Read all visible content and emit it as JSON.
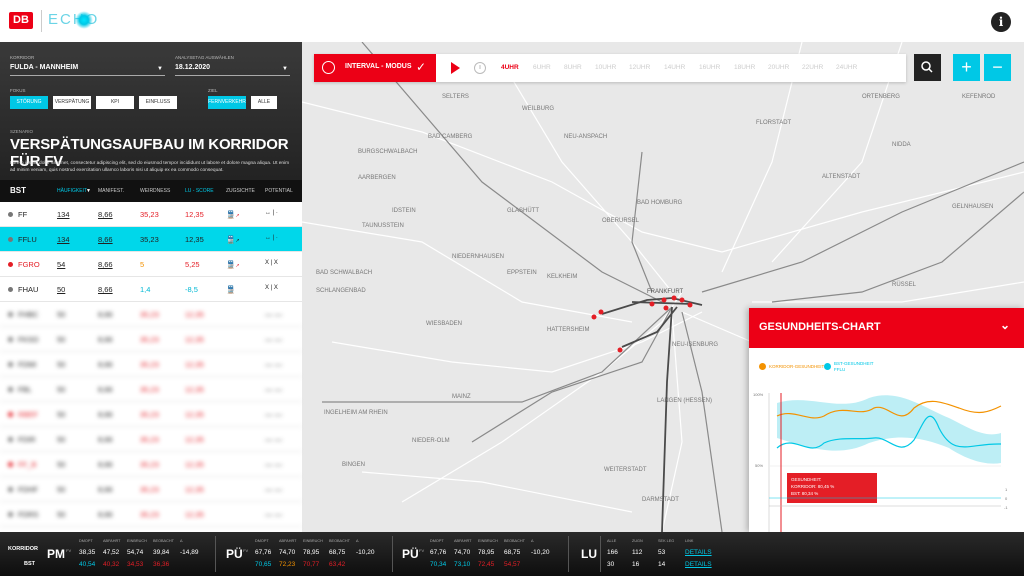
{
  "app": {
    "logo_text": "DB",
    "name": "ECHO",
    "info_icon": "i"
  },
  "filters": {
    "korridor_label": "KORRIDOR",
    "korridor_value": "FULDA - MANNHEIM",
    "date_label": "ANALYSETAG AUSWÄHLEN",
    "date_value": "18.12.2020",
    "fokus_label": "FOKUS",
    "fokus_chips": [
      "STÖRUNG",
      "VERSPÄTUNG",
      "KPI",
      "EINFLUSS"
    ],
    "ziel_label": "ZIEL",
    "ziel_chips": [
      "FERNVERKEHR",
      "ALLE"
    ]
  },
  "scenario": {
    "label": "SZENARIO",
    "title": "VERSPÄTUNGSAUFBAU IM KORRIDOR FÜR FV",
    "description": "Lorem ipsum dolor sit amet, consectetur adipiscing elit, sed do eiusmod tempor incididunt ut labore et dolore magna aliqua. Ut enim ad minim veniam, quis nostrud exercitation ullamco laboris nisi ut aliquip ex ea commodo consequat."
  },
  "table": {
    "headers": [
      "BST",
      "HÄUFIGKEIT",
      "MANIFEST.",
      "WEIRDNESS",
      "LU - SCORE",
      "ZUGSICHTE",
      "POTENTIAL"
    ],
    "rows": [
      {
        "name": "FF",
        "haeufigkeit": "134",
        "manifest": "8,66",
        "weirdness": "35,23",
        "lu": "12,35",
        "potential": "↔ | ·"
      },
      {
        "name": "FFLU",
        "haeufigkeit": "134",
        "manifest": "8,66",
        "weirdness": "35,23",
        "lu": "12,35",
        "potential": "↔ | ·"
      },
      {
        "name": "FGRO",
        "haeufigkeit": "54",
        "manifest": "8,66",
        "weirdness": "5",
        "lu": "5,25",
        "potential": "X | X"
      },
      {
        "name": "FHAU",
        "haeufigkeit": "50",
        "manifest": "8,66",
        "weirdness": "1,4",
        "lu": "-8,5",
        "potential": "X | X"
      },
      {
        "name": "FHBC",
        "haeufigkeit": "50",
        "manifest": "8,66",
        "weirdness": "35,23",
        "lu": "12,35",
        "potential": "— —"
      },
      {
        "name": "FKSO",
        "haeufigkeit": "50",
        "manifest": "8,66",
        "weirdness": "35,23",
        "lu": "12,35",
        "potential": "— —"
      },
      {
        "name": "FDMI",
        "haeufigkeit": "50",
        "manifest": "8,66",
        "weirdness": "35,23",
        "lu": "12,35",
        "potential": "— —"
      },
      {
        "name": "FBL",
        "haeufigkeit": "50",
        "manifest": "8,66",
        "weirdness": "35,23",
        "lu": "12,35",
        "potential": "— —"
      },
      {
        "name": "RBEF",
        "haeufigkeit": "50",
        "manifest": "8,66",
        "weirdness": "35,23",
        "lu": "12,35",
        "potential": "— —"
      },
      {
        "name": "FDIR",
        "haeufigkeit": "50",
        "manifest": "8,66",
        "weirdness": "35,23",
        "lu": "12,35",
        "potential": "— —"
      },
      {
        "name": "FF_B",
        "haeufigkeit": "50",
        "manifest": "8,66",
        "weirdness": "35,23",
        "lu": "12,35",
        "potential": "— —"
      },
      {
        "name": "FDHF",
        "haeufigkeit": "50",
        "manifest": "8,66",
        "weirdness": "35,23",
        "lu": "12,35",
        "potential": "— —"
      },
      {
        "name": "FDRS",
        "haeufigkeit": "50",
        "manifest": "8,66",
        "weirdness": "35,23",
        "lu": "12,35",
        "potential": "— —"
      }
    ]
  },
  "bottom": {
    "row_labels": [
      "KORRIDOR",
      "BST"
    ],
    "groups": [
      {
        "code": "PM",
        "sup": "FV",
        "headers": [
          "DMOPT",
          "ABFAHRT",
          "EINBRUCH",
          "BEOBACHT",
          "Δ"
        ],
        "row1": [
          "38,35",
          "47,52",
          "54,74",
          "39,84",
          "-14,89"
        ],
        "row2": [
          "40,54",
          "40,32",
          "34,53",
          "36,36",
          ""
        ]
      },
      {
        "code": "PÜ",
        "sup": "FV",
        "headers": [
          "DMOPT",
          "ABFAHRT",
          "EINBRUCH",
          "BEOBACHT",
          "Δ"
        ],
        "row1": [
          "67,76",
          "74,70",
          "78,95",
          "68,75",
          "-10,20"
        ],
        "row2": [
          "70,65",
          "72,23",
          "70,77",
          "63,42",
          ""
        ]
      },
      {
        "code": "PÜ",
        "sup": "FV",
        "headers": [
          "DMOPT",
          "ABFAHRT",
          "EINBRUCH",
          "BEOBACHT",
          "Δ"
        ],
        "row1": [
          "67,76",
          "74,70",
          "78,95",
          "68,75",
          "-10,20"
        ],
        "row2": [
          "70,34",
          "73,10",
          "72,45",
          "54,57",
          ""
        ]
      }
    ],
    "lu": {
      "code": "LU",
      "headers": [
        "ALLE",
        "ZUGN",
        "SEK LEG",
        "LINK"
      ],
      "row1": [
        "166",
        "112",
        "53",
        "DETAILS"
      ],
      "row2": [
        "30",
        "16",
        "14",
        "DETAILS"
      ]
    }
  },
  "interval": {
    "mode_label": "INTERVAL - MODUS",
    "hours": [
      "4UHR",
      "6UHR",
      "8UHR",
      "10UHR",
      "12UHR",
      "14UHR",
      "16UHR",
      "18UHR",
      "20UHR",
      "22UHR",
      "24UHR"
    ],
    "active_hour": "4UHR"
  },
  "map": {
    "labels": [
      "SELTERS",
      "WEILBURG",
      "BAD CAMBERG",
      "NEU-ANSPACH",
      "FLORSTADT",
      "BURGSCHWALBACH",
      "AARBERGEN",
      "GLASHÜTT",
      "OBERURSEL",
      "BAD HOMBURG",
      "IDSTEIN",
      "TAUNUSSTEIN",
      "NIEDERNHAUSEN",
      "EPPSTEIN",
      "KELKHEIM",
      "BAD SCHWALBACH",
      "SCHLANGENBAD",
      "WIESBADEN",
      "HATTERSHEIM",
      "NEU-ISENBURG",
      "MAINZ",
      "INGELHEIM AM RHEIN",
      "BINGEN",
      "NIEDER-OLM",
      "DARMSTADT",
      "WEITERSTADT",
      "LANGEN (HESSEN)",
      "FRANKFURT",
      "ORTENBERG",
      "KEFENROD",
      "GELNHAUSEN",
      "RÜSSEL",
      "NIDDA",
      "ALTENSTADT"
    ]
  },
  "health": {
    "title": "GESUNDHEITS-CHART",
    "legend": [
      "KORRIDOR-GESUNDHEIT",
      "BST-GESUNDHEIT FFLU"
    ],
    "y_labels": [
      "100%",
      "50%",
      "0%"
    ],
    "x_labels": [
      "4Uhr",
      "6Uhr",
      "8Uhr",
      "10Uhr",
      "12Uhr",
      "14Uhr",
      "16Uhr",
      "18Uhr",
      "20Uhr",
      "22Uhr",
      "24Uhr"
    ],
    "tooltip": [
      "GESUNDHEIT:",
      "KORRIDOR: 80,45 %",
      "BST: 80,34 %"
    ],
    "colors": {
      "korridor": "#f39200",
      "bst": "#00c8e6"
    },
    "right_ticks": [
      "1",
      "0",
      "-1"
    ]
  }
}
